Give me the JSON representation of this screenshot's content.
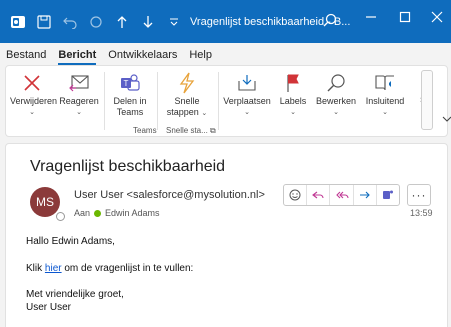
{
  "window": {
    "title": "Vragenlijst beschikbaarheid - B...",
    "app_icon": "outlook-icon",
    "colors": {
      "titlebar": "#0f6cbd",
      "accent": "#0f6cbd"
    }
  },
  "menu": {
    "tabs": [
      {
        "label": "Bestand"
      },
      {
        "label": "Bericht"
      },
      {
        "label": "Ontwikkelaars"
      },
      {
        "label": "Help"
      }
    ],
    "active_tab": "Bericht"
  },
  "ribbon": {
    "delete": {
      "label": "Verwijderen",
      "icon": "delete-x-icon"
    },
    "respond": {
      "label": "Reageren",
      "icon": "reply-envelope-icon"
    },
    "teams_share": {
      "label1": "Delen in",
      "label2": "Teams",
      "icon": "teams-icon"
    },
    "quick_steps": {
      "label1": "Snelle",
      "label2": "stappen",
      "icon": "lightning-icon"
    },
    "move": {
      "label": "Verplaatsen",
      "icon": "move-tray-icon"
    },
    "labels": {
      "label": "Labels",
      "icon": "flag-icon"
    },
    "edit": {
      "label": "Bewerken",
      "icon": "search-icon"
    },
    "immersive": {
      "label": "Insluitend",
      "icon": "immersive-reader-icon"
    },
    "group_labels": {
      "teams": "Teams",
      "quick_steps": "Snelle sta..."
    }
  },
  "message": {
    "subject": "Vragenlijst beschikbaarheid",
    "avatar_initials": "MS",
    "sender": "User User <salesforce@mysolution.nl>",
    "to_prefix": "Aan",
    "to_name": "Edwin Adams",
    "time": "13:59",
    "body": {
      "greeting": "Hallo Edwin Adams,",
      "line_prefix": "Klik",
      "link_text": "hier",
      "line_suffix": "om de vragenlijst in te vullen:",
      "closing1": "Met vriendelijke groet,",
      "closing2": "User User"
    }
  }
}
